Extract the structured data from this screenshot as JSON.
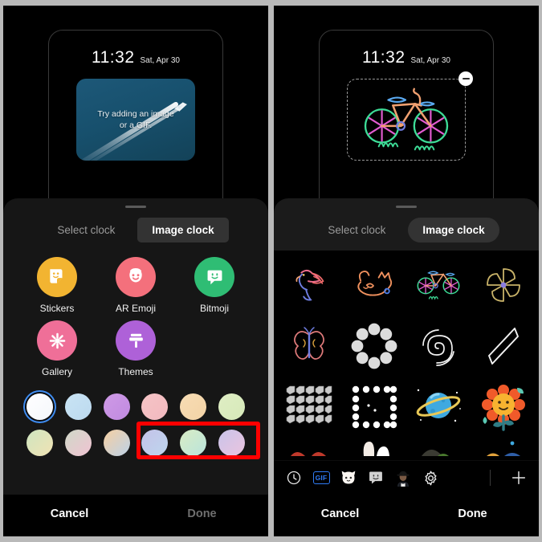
{
  "meta": {
    "accent_red": "#fe0000",
    "accent_blue": "#3f8cf0",
    "sheet_bg": "#161616"
  },
  "left_panel": {
    "preview": {
      "clock_time": "11:32",
      "clock_date": "Sat, Apr 30",
      "placeholder_line1": "Try adding an image",
      "placeholder_line2": "or a GIF.",
      "image_name": "jet-contrail-photo"
    },
    "tabs": [
      {
        "label": "Select clock",
        "active": false
      },
      {
        "label": "Image clock",
        "active": true,
        "highlighted": true
      }
    ],
    "apps": [
      {
        "label": "Stickers",
        "icon": "stickers-icon",
        "color": "#f2b431"
      },
      {
        "label": "AR Emoji",
        "icon": "ar-emoji-icon",
        "color": "#f4707c"
      },
      {
        "label": "Bitmoji",
        "icon": "bitmoji-icon",
        "color": "#2fbd74"
      },
      {
        "label": "Gallery",
        "icon": "gallery-icon",
        "color": "#ef6f98"
      },
      {
        "label": "Themes",
        "icon": "themes-icon",
        "color": "#ae61d8"
      }
    ],
    "swatches": [
      {
        "name": "white",
        "selected": true,
        "from": "#ffffff",
        "to": "#f4f7fb"
      },
      {
        "name": "light-blue",
        "selected": false,
        "from": "#c9e4f4",
        "to": "#bcd9ef"
      },
      {
        "name": "purple",
        "selected": false,
        "from": "#cf9ae6",
        "to": "#c08ae0"
      },
      {
        "name": "pink",
        "selected": false,
        "from": "#f6c4c6",
        "to": "#f2b9bf"
      },
      {
        "name": "peach",
        "selected": false,
        "from": "#f7dcb4",
        "to": "#f3d3a6"
      },
      {
        "name": "light-green",
        "selected": false,
        "from": "#dfeec4",
        "to": "#d6e9b9"
      },
      {
        "name": "green-yellow-gradient",
        "selected": false,
        "from": "#cfe6c0",
        "to": "#f0e2b4"
      },
      {
        "name": "pink-green-gradient",
        "selected": false,
        "from": "#cfd9c8",
        "to": "#f0c3d2"
      },
      {
        "name": "orange-blue-gradient",
        "selected": false,
        "from": "#f6cfa2",
        "to": "#bcd2e8"
      },
      {
        "name": "blue-purple-gradient",
        "selected": false,
        "from": "#c5c2e8",
        "to": "#bdd6ee"
      },
      {
        "name": "mint-gradient",
        "selected": false,
        "from": "#d9ecc4",
        "to": "#b9e4dc"
      },
      {
        "name": "lilac-pink-gradient",
        "selected": false,
        "from": "#c9c4ea",
        "to": "#ebc4de"
      }
    ],
    "actions": {
      "cancel": "Cancel",
      "done": "Done",
      "done_enabled": false
    }
  },
  "right_panel": {
    "preview": {
      "clock_time": "11:32",
      "clock_date": "Sat, Apr 30",
      "sticker_name": "neon-bicycle-sticker",
      "remove_icon": "minus-circle-icon"
    },
    "tabs": [
      {
        "label": "Select clock",
        "active": false
      },
      {
        "label": "Image clock",
        "active": true,
        "highlighted": false
      }
    ],
    "stickers": [
      {
        "name": "neon-parrot-sticker"
      },
      {
        "name": "neon-cat-sticker"
      },
      {
        "name": "neon-bicycle-sticker"
      },
      {
        "name": "neon-pinwheel-sticker"
      },
      {
        "name": "neon-butterfly-sticker"
      },
      {
        "name": "dot-ring-sticker"
      },
      {
        "name": "spiral-sticker"
      },
      {
        "name": "parallelogram-sticker"
      },
      {
        "name": "cube-grid-sticker"
      },
      {
        "name": "dot-square-sticker"
      },
      {
        "name": "planet-sticker"
      },
      {
        "name": "sunflower-sticker"
      }
    ],
    "toolbar": [
      {
        "name": "clock-icon",
        "label": ""
      },
      {
        "name": "gif-icon",
        "label": "GIF",
        "active": true
      },
      {
        "name": "cat-sticker-icon",
        "label": ""
      },
      {
        "name": "bitmoji-icon",
        "label": ""
      },
      {
        "name": "ar-emoji-icon",
        "label": ""
      },
      {
        "name": "settings-gear-icon",
        "label": ""
      },
      {
        "name": "add-icon",
        "label": ""
      }
    ],
    "actions": {
      "cancel": "Cancel",
      "done": "Done",
      "done_enabled": true
    }
  }
}
